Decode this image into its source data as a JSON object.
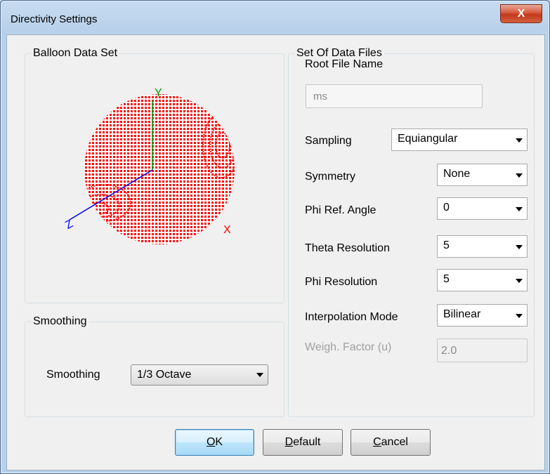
{
  "window": {
    "title": "Directivity Settings",
    "close_label": "X"
  },
  "balloon": {
    "group_title": "Balloon Data Set",
    "axis_labels": {
      "x": "X",
      "y": "Y",
      "z": "Z"
    },
    "sphere_color": "#ff0000"
  },
  "smoothing": {
    "group_title": "Smoothing",
    "label": "Smoothing",
    "value": "1/3 Octave"
  },
  "data_files": {
    "group_title": "Set Of Data Files",
    "root_file_label": "Root File Name",
    "root_file_value": "ms",
    "fields": [
      {
        "label": "Sampling",
        "value": "Equiangular"
      },
      {
        "label": "Symmetry",
        "value": "None"
      },
      {
        "label": "Phi Ref. Angle",
        "value": "0"
      },
      {
        "label": "Theta Resolution",
        "value": "5"
      },
      {
        "label": "Phi Resolution",
        "value": "5"
      },
      {
        "label": "Interpolation Mode",
        "value": "Bilinear"
      }
    ],
    "weigh_label": "Weigh. Factor (u)",
    "weigh_value": "2.0"
  },
  "buttons": {
    "ok": {
      "mnemonic": "O",
      "rest": "K"
    },
    "default": {
      "mnemonic": "D",
      "rest": "efault"
    },
    "cancel": {
      "mnemonic": "C",
      "rest": "ancel"
    }
  }
}
